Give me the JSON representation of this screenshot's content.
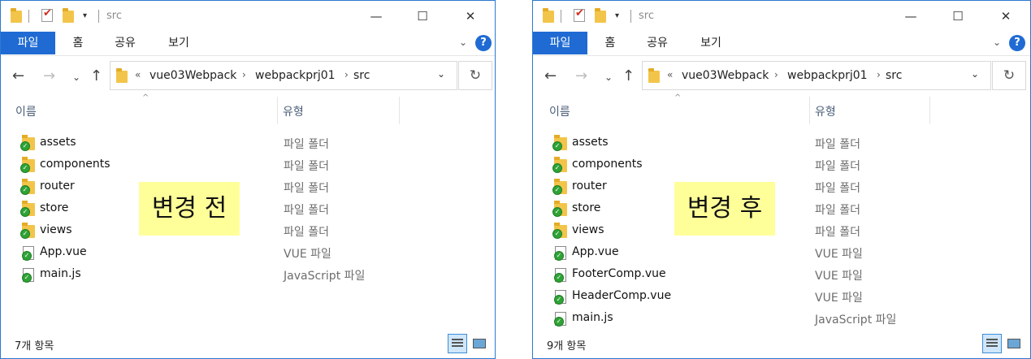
{
  "left_window": {
    "title": "src",
    "ribbon": {
      "tabs": [
        "파일",
        "홈",
        "공유",
        "보기"
      ]
    },
    "address": {
      "crumbs": [
        "vue03Webpack",
        "webpackprj01",
        "src"
      ]
    },
    "columns": {
      "name": "이름",
      "type": "유형"
    },
    "files": [
      {
        "name": "assets",
        "type": "파일 폴더",
        "kind": "folder"
      },
      {
        "name": "components",
        "type": "파일 폴더",
        "kind": "folder"
      },
      {
        "name": "router",
        "type": "파일 폴더",
        "kind": "folder"
      },
      {
        "name": "store",
        "type": "파일 폴더",
        "kind": "folder"
      },
      {
        "name": "views",
        "type": "파일 폴더",
        "kind": "folder"
      },
      {
        "name": "App.vue",
        "type": "VUE 파일",
        "kind": "file"
      },
      {
        "name": "main.js",
        "type": "JavaScript 파일",
        "kind": "file"
      }
    ],
    "overlay_label": "변경 전",
    "status": "7개 항목"
  },
  "right_window": {
    "title": "src",
    "ribbon": {
      "tabs": [
        "파일",
        "홈",
        "공유",
        "보기"
      ]
    },
    "address": {
      "crumbs": [
        "vue03Webpack",
        "webpackprj01",
        "src"
      ]
    },
    "columns": {
      "name": "이름",
      "type": "유형"
    },
    "files": [
      {
        "name": "assets",
        "type": "파일 폴더",
        "kind": "folder"
      },
      {
        "name": "components",
        "type": "파일 폴더",
        "kind": "folder"
      },
      {
        "name": "router",
        "type": "파일 폴더",
        "kind": "folder"
      },
      {
        "name": "store",
        "type": "파일 폴더",
        "kind": "folder"
      },
      {
        "name": "views",
        "type": "파일 폴더",
        "kind": "folder"
      },
      {
        "name": "App.vue",
        "type": "VUE 파일",
        "kind": "file"
      },
      {
        "name": "FooterComp.vue",
        "type": "VUE 파일",
        "kind": "file"
      },
      {
        "name": "HeaderComp.vue",
        "type": "VUE 파일",
        "kind": "file"
      },
      {
        "name": "main.js",
        "type": "JavaScript 파일",
        "kind": "file"
      }
    ],
    "overlay_label": "변경 후",
    "status": "9개 항목"
  },
  "colors": {
    "accent": "#1f6bd3",
    "label_bg": "#ffff99",
    "sync_badge": "#2fa336",
    "folder": "#f2c54a"
  },
  "icons": {
    "folder": "folder-icon",
    "file": "file-icon",
    "sync": "sync-ok-icon",
    "help": "help-icon"
  }
}
